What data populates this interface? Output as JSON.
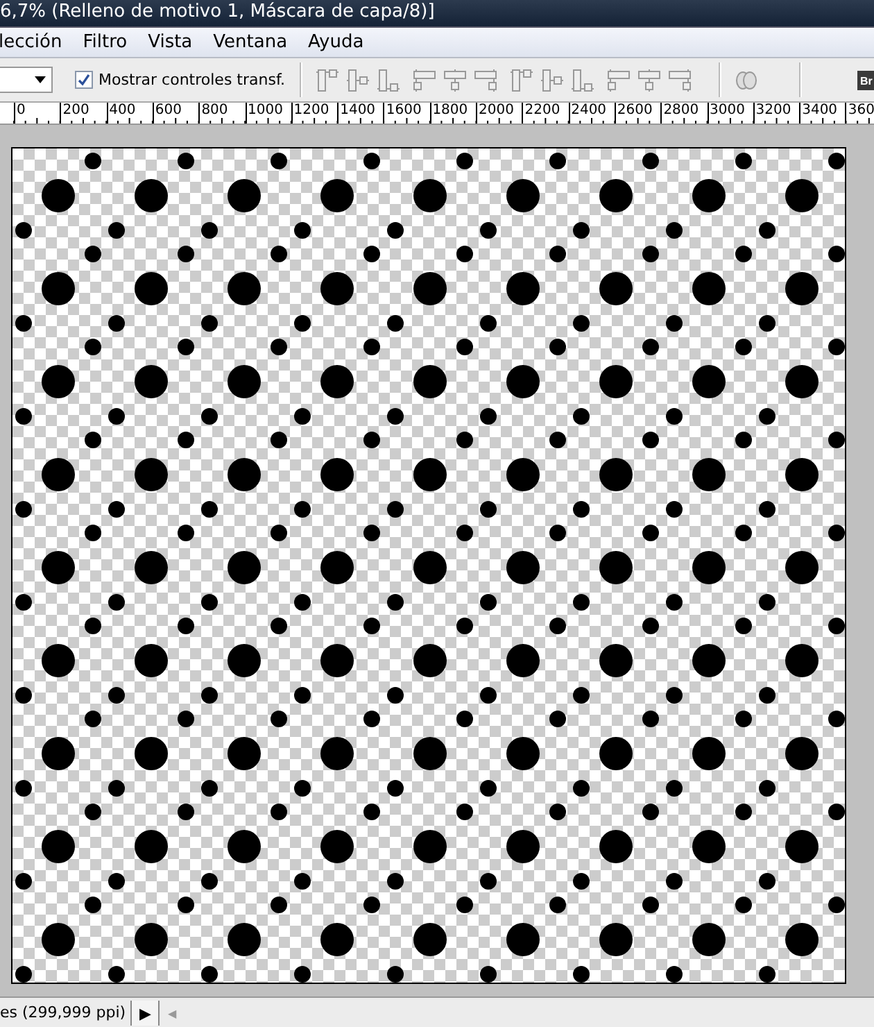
{
  "window": {
    "title": "6,7% (Relleno de motivo 1, Máscara de capa/8)]"
  },
  "menu": [
    "lección",
    "Filtro",
    "Vista",
    "Ventana",
    "Ayuda"
  ],
  "options_bar": {
    "show_transform": {
      "label": "Mostrar controles transf.",
      "checked": true
    }
  },
  "ruler": [
    "0",
    "200",
    "400",
    "600",
    "800",
    "1000",
    "1200",
    "1400",
    "1600",
    "1800",
    "2000",
    "2200",
    "2400",
    "2600",
    "2800",
    "3000",
    "3200",
    "3400",
    "360"
  ],
  "app_badge": "Br",
  "status_bar": {
    "text": "es (299,999 ppi)",
    "menu_arrow": "▶",
    "scroll_arrow": "◀"
  }
}
